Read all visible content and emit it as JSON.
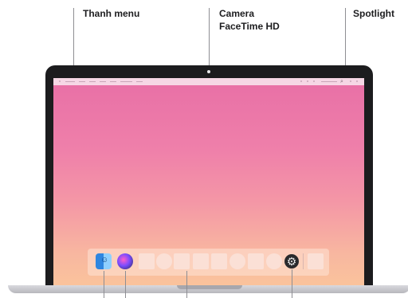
{
  "callouts": {
    "menu_bar": "Thanh menu",
    "camera_line1": "Camera",
    "camera_line2": "FaceTime HD",
    "spotlight": "Spotlight"
  },
  "icons": {
    "spotlight_glyph": "search-icon",
    "finder": "finder-icon",
    "siri": "siri-icon",
    "system_preferences": "gear-icon"
  },
  "colors": {
    "bezel": "#1c1c1e",
    "wallpaper_top": "#e86fa6",
    "wallpaper_bottom": "#fac39c",
    "leader_line": "#8e8e93"
  },
  "glyphs": {
    "finder_face": "☺",
    "spotlight": "⌕",
    "prefs": "⚙"
  }
}
